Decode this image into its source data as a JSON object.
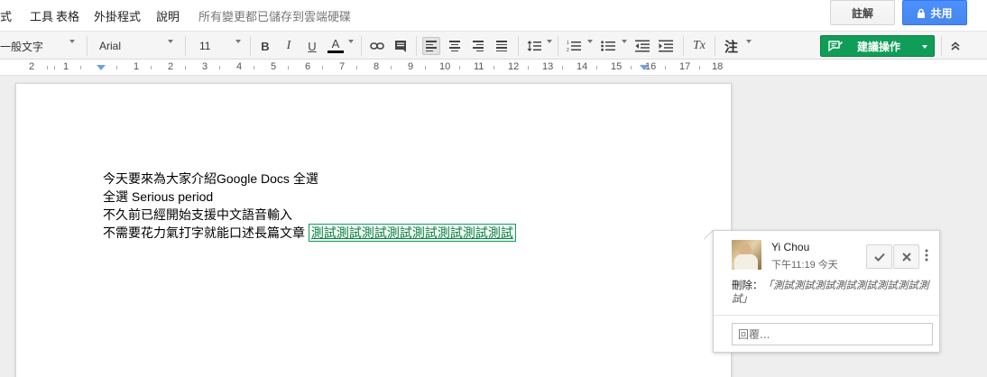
{
  "menubar": {
    "items": [
      "式",
      "工具",
      "表格",
      "外掛程式",
      "說明"
    ],
    "saved_status": "所有變更都已儲存到雲端硬碟",
    "comment_button": "註解",
    "share_button": "共用"
  },
  "toolbar": {
    "style": "一般文字",
    "font": "Arial",
    "size": "11",
    "bold": "B",
    "italic": "I",
    "underline": "U",
    "text_color": "A",
    "text_color_value": "#000000",
    "clear_format": "Tx",
    "footnote": "注",
    "suggest_button": "建議操作",
    "accent_green": "#0f9d58",
    "share_blue": "#4d90fe"
  },
  "ruler": {
    "labels": [
      "2",
      "1",
      "1",
      "2",
      "3",
      "4",
      "5",
      "6",
      "7",
      "8",
      "9",
      "10",
      "11",
      "12",
      "13",
      "14",
      "15",
      "16",
      "17",
      "18"
    ]
  },
  "document": {
    "lines": [
      "今天要來為大家介紹Google Docs 全選",
      "全選 Serious period",
      "不久前已經開始支援中文語音輸入",
      "不需要花力氣打字就能口述長篇文章 "
    ],
    "suggestion": "測試測試測試測試測試測試測試測試"
  },
  "comment": {
    "author": "Yi Chou",
    "time": "下午11:19 今天",
    "delete_label": "刪除：",
    "deleted_text": "「測試測試測試測試測試測試測試測試」",
    "reply_placeholder": "回覆..."
  }
}
